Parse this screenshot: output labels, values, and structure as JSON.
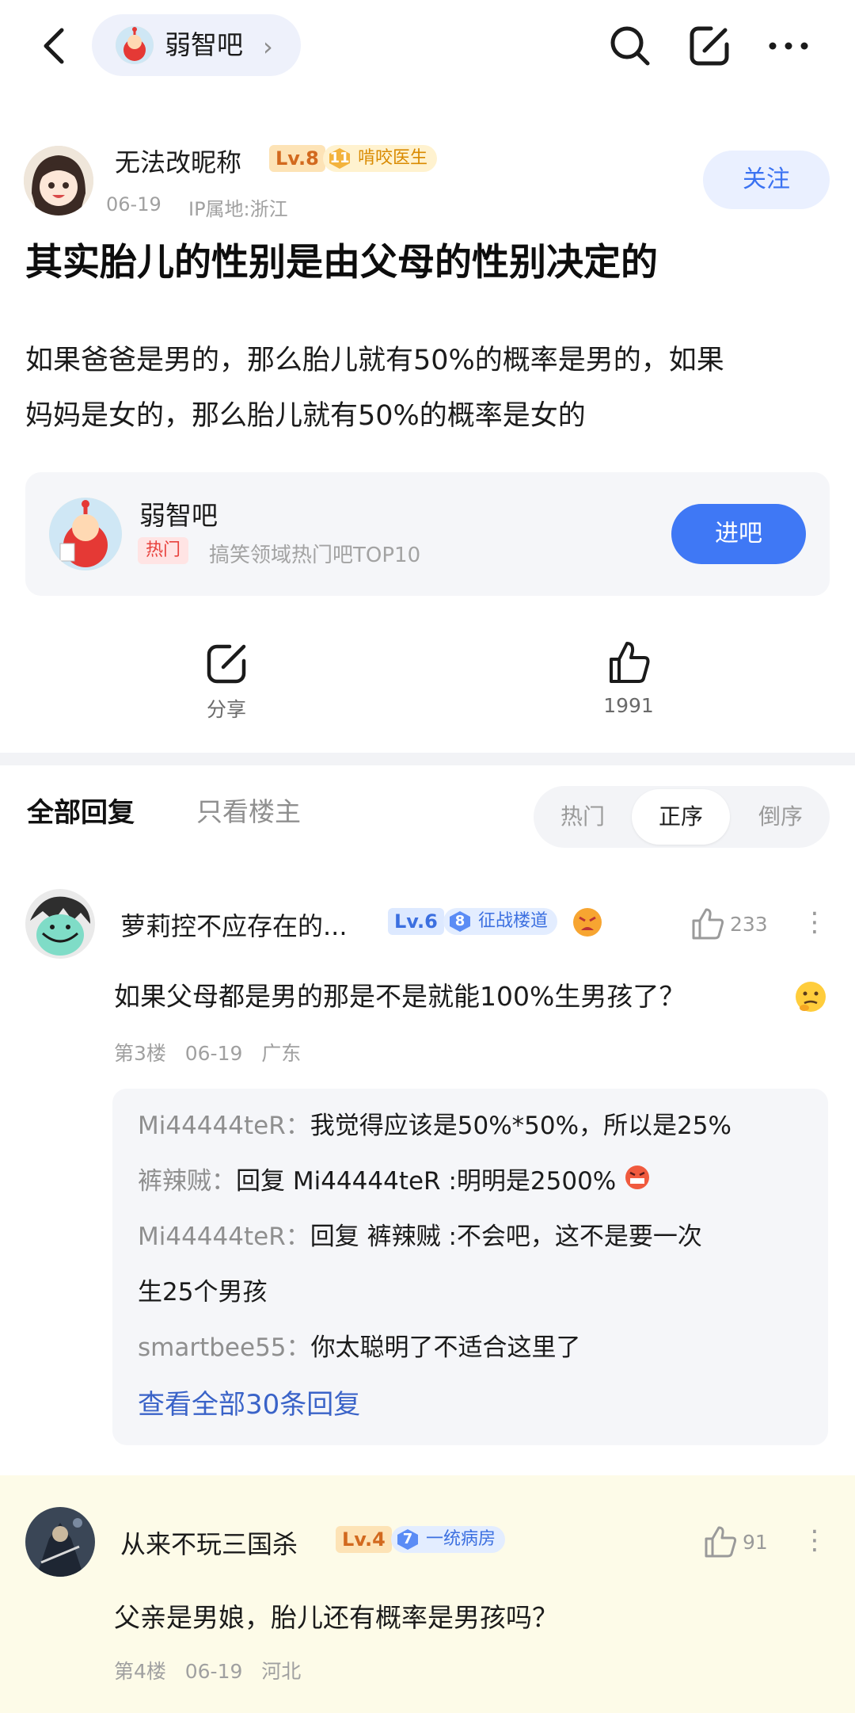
{
  "nav": {
    "forum_name": "弱智吧",
    "chevron": "›"
  },
  "post": {
    "author": "无法改昵称",
    "level": "Lv.8",
    "role_level": "11",
    "role": "啃咬医生",
    "date": "06-19",
    "ip": "IP属地:浙江",
    "follow_label": "关注",
    "title": "其实胎儿的性别是由父母的性别决定的",
    "body_line1": "如果爸爸是男的，那么胎儿就有50%的概率是男的，如果",
    "body_line2": "妈妈是女的，那么胎儿就有50%的概率是女的"
  },
  "forum_card": {
    "name": "弱智吧",
    "hot_tag": "热门",
    "desc": "搞笑领域热门吧TOP10",
    "enter_label": "进吧"
  },
  "actions": {
    "share_label": "分享",
    "like_count": "1991"
  },
  "tabs": {
    "all": "全部回复",
    "op_only": "只看楼主",
    "sort_hot": "热门",
    "sort_asc": "正序",
    "sort_desc": "倒序"
  },
  "comments": [
    {
      "user": "萝莉控不应存在的...",
      "level": "Lv.6",
      "role_level": "8",
      "role": "征战楼道",
      "likes": "233",
      "text": "如果父母都是男的那是不是就能100%生男孩了？",
      "floor": "第3楼",
      "date": "06-19",
      "location": "广东",
      "replies": [
        {
          "user": "Mi44444teR：",
          "text": "我觉得应该是50%*50%，所以是25%"
        },
        {
          "user": "裤辣贼：",
          "text": "回复 Mi44444teR :明明是2500%"
        },
        {
          "user": "Mi44444teR：",
          "text": "回复 裤辣贼 :不会吧，这不是要一次"
        },
        {
          "user": "",
          "text": "生25个男孩"
        },
        {
          "user": "smartbee55：",
          "text": "你太聪明了不适合这里了"
        }
      ],
      "more_replies": "查看全部30条回复"
    },
    {
      "user": "从来不玩三国杀",
      "level": "Lv.4",
      "role_level": "7",
      "role": "一统病房",
      "likes": "91",
      "text": "父亲是男娘，胎儿还有概率是男孩吗？",
      "floor": "第4楼",
      "date": "06-19",
      "location": "河北"
    }
  ],
  "more_glyph": "⋮",
  "colors": {
    "accent": "#3f78f5",
    "hot": "#e8413c",
    "highlight": "#fdfbe8"
  }
}
